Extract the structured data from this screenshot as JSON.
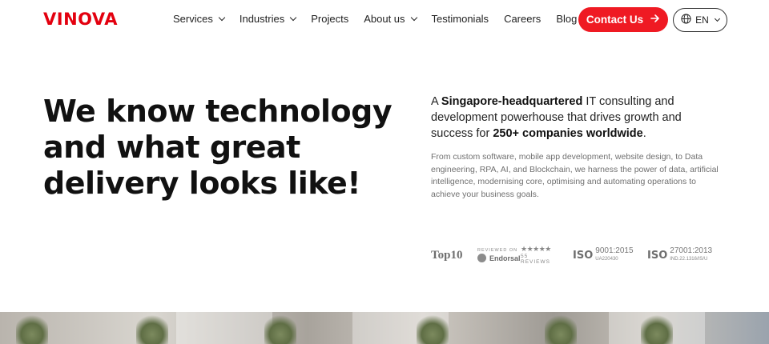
{
  "header": {
    "logo": "VINOVA",
    "nav": [
      {
        "label": "Services",
        "dropdown": true
      },
      {
        "label": "Industries",
        "dropdown": true
      },
      {
        "label": "Projects",
        "dropdown": false
      },
      {
        "label": "About us",
        "dropdown": true
      },
      {
        "label": "Testimonials",
        "dropdown": false
      },
      {
        "label": "Careers",
        "dropdown": false
      },
      {
        "label": "Blog",
        "dropdown": false
      }
    ],
    "contact_label": "Contact Us",
    "language": "EN"
  },
  "hero": {
    "title": "We know technology and what great delivery looks like!",
    "lead": {
      "p1": "A ",
      "e1": "Singapore-headquartered",
      "p2": " IT consulting and development powerhouse that drives growth and success for ",
      "e2": "250+ companies worldwide",
      "p3": "."
    },
    "description": "From custom software, mobile app development, website design, to Data engineering, RPA, AI, and Blockchain, we harness the power of data, artificial intelligence, modernising core, optimising and automating operations to achieve your business goals."
  },
  "badges": {
    "top10": "Top10",
    "endorsal_reviewed_on": "REVIEWED ON",
    "endorsal_name": "Endorsal",
    "endorsal_stars": "★★★★★",
    "endorsal_reviews": "55 REVIEWS",
    "iso1_logo": "ISO",
    "iso1_number": "9001:2015",
    "iso1_code": "UA220430",
    "iso2_logo": "ISO",
    "iso2_number": "27001:2013",
    "iso2_code": "IND.22.1316/IS/U"
  },
  "colors": {
    "brand": "#e3000f",
    "contact_button": "#ef1a23"
  }
}
